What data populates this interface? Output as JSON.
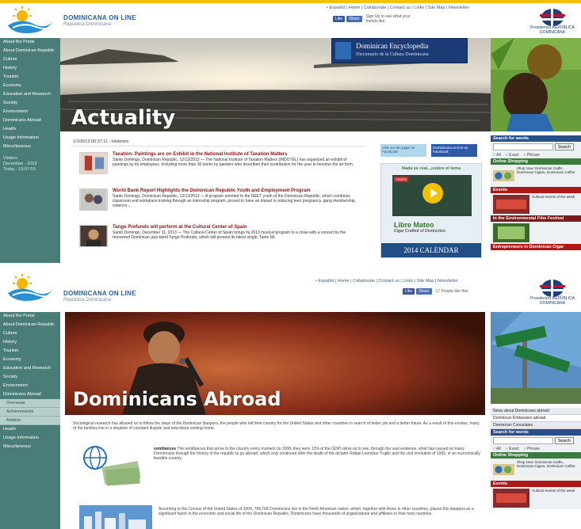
{
  "screen1": {
    "header": {
      "brand_name": "DOMINICANA ON LINE",
      "brand_sub": "República Dominicana",
      "top_links": "• Español | Home | Collaborate | Contact us | Links | Site Map | Newsletter",
      "share_like": "Like",
      "share_share": "Share",
      "share_caption": "Sign Up to see what your friends like.",
      "emblem_text": "Presidencia REPÚBLICA DOMINICANA"
    },
    "sidebar": {
      "items": [
        "About the Portal",
        "About Dominican Republic",
        "Culture",
        "History",
        "Tourism",
        "Economy",
        "Education and Research",
        "Society",
        "Environment",
        "Dominicans Abroad",
        "Health",
        "Usage Information",
        "Miscellaneous"
      ],
      "counter": "Visitors\nDecember - 2013\nToday : 13:07:03"
    },
    "banner": {
      "title": "Dominican Encyclopedia",
      "subtitle": "Diccionario de la Cultura Dominicana"
    },
    "hero_title": "Actuality",
    "date_line": "1/1/2013 06:37:11 - Histories",
    "articles": [
      {
        "title": "Taxation: Paintings are on Exhibit in the National Institute of Taxation Matters",
        "desc": "Santo Domingo, Dominican Republic, 12/13/2013 — The National Institute of Taxation Matters (INDOTEL) has organized an exhibit of paintings by its employees. Including more than 30 works by painters who described their contribution for the year to become the art form."
      },
      {
        "title": "World Bank Report Highlights the Dominican Republic Youth and Employment Program",
        "desc": "Santo Domingo, Dominican Republic, 12/13/2013 — A program oriented to the NEET youth of the Dominican Republic, which combines classroom and workplace training through an internship program, proved to have an impact in reducing teen pregnancy, gang membership, violence..."
      },
      {
        "title": "Tango Profundo will perform at the Cultural Center of Spain",
        "desc": "Santo Domingo, December 11, 2013 — The Cultural Center of Spain brings its 2013 musical program to a close with a concert by the renowned Dominican jazz band Tango Profundo, which will present its latest single, Tanto Mi."
      }
    ],
    "ads": {
      "ad1": "Visit our fan page on Facebook",
      "ad2": "Dominicana on line on Facebook",
      "video_heading": "Nada es real...¡sobre el tema",
      "video_badge": "VIDEO",
      "brand": "Libre Mateo",
      "brand_sub": "Cigar Crafted of Distinction",
      "calendar": "2014 CALENDAR"
    },
    "right": {
      "search_header": "Search for words",
      "search_btn": "Search",
      "radios": [
        "All",
        "Exact",
        "Phrase"
      ],
      "box1": "Online Shopping",
      "box1_lines": "Shop Now: Dominican Crafts, Dominican Cigars, Dominican Coffee",
      "box2": "Events",
      "box2_lines": "Cultural events of the week",
      "box3": "In the Environmental Film Festival",
      "box4": "Entrepreneurs in Dominican Cigar"
    }
  },
  "screen2": {
    "header": {
      "brand_name": "DOMINICANA ON LINE",
      "brand_sub": "República Dominicana",
      "top_links": "• Español | Home | Collaborate | Contact us | Links | Site Map | Newsletter",
      "share_like": "Like",
      "share_share": "Share",
      "share_caption": "17 People like this.",
      "emblem_text": "Presidencia REPÚBLICA DOMINICANA"
    },
    "sidebar": {
      "items": [
        "About the Portal",
        "About Dominican Republic",
        "Culture",
        "History",
        "Tourism",
        "Economy",
        "Education and Research",
        "Society",
        "Environment",
        "Dominicans Abroad"
      ],
      "subitems": [
        "Overseas",
        "Achievements",
        "Addicts"
      ],
      "items_after": [
        "Health",
        "Usage Information",
        "Miscellaneous"
      ]
    },
    "hero_title": "Dominicans Abroad",
    "intro": "Sociological research has allowed us to follow the steps of the Dominican diaspora, the people who left their country for the United States and other countries in search of better job and a better future. As a result of this exodus, many of the families live in a situation of constant dispute and new ideas coming home.",
    "para1": "The remittances that arrive to the country every moment (in 2008, they were 12% of the GDP) allow us to see, through the vast evidence, what has caused so many Dominicans through the history of the republic to go abroad, which only continued after the death of the dictator Rafael Leonidas Trujillo and the civil revolution of 1965, in an economically feasible country.",
    "para1_bold": "remittances",
    "para2": "According to the Census of the United States of 2000, 799,768 Dominicans live in the North American nation, which, together with those in other countries, places this diaspora as a significant factor in the economic and social life of the Dominican Republic. Dominicans have thousands of organizations and affiliates in their host countries.",
    "right": {
      "links": [
        "News about Dominicans abroad",
        "Dominican Embassies abroad",
        "Dominican Consulates"
      ],
      "search_header": "Search for words",
      "search_btn": "Search",
      "radios": [
        "All",
        "Exact",
        "Phrase"
      ],
      "box1": "Online Shopping",
      "box1_lines": "Shop Now: Dominican Crafts, Dominican Cigars, Dominican Coffee",
      "box2": "Events",
      "box2_lines": "Cultural events of the week"
    }
  },
  "colors": {
    "sidebar": "#4a7d78",
    "brand_blue": "#2b5e9a",
    "accent_yellow": "#f2c200",
    "box_red": "#7a1a1a"
  }
}
